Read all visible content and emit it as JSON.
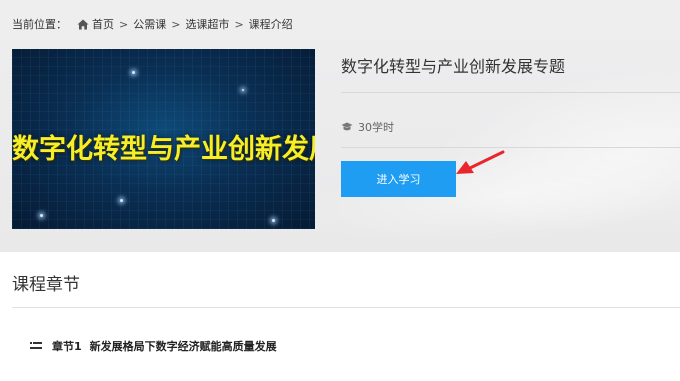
{
  "breadcrumb": {
    "prefix": "当前位置：",
    "items": [
      "首页",
      "公需课",
      "选课超市",
      "课程介绍"
    ],
    "separator": ">"
  },
  "course": {
    "image_text": "数字化转型与产业创新发展",
    "title": "数字化转型与产业创新发展专题",
    "hours": "30学时",
    "enter_button": "进入学习"
  },
  "chapters": {
    "section_title": "课程章节",
    "items": [
      {
        "number": "章节1",
        "title": "新发展格局下数字经济赋能高质量发展"
      }
    ]
  },
  "colors": {
    "accent": "#1e9df2",
    "image_text": "#f5ef2a",
    "arrow": "#e8262b"
  },
  "icons": [
    "home-icon",
    "graduation-cap-icon",
    "list-icon",
    "red-arrow-icon"
  ]
}
